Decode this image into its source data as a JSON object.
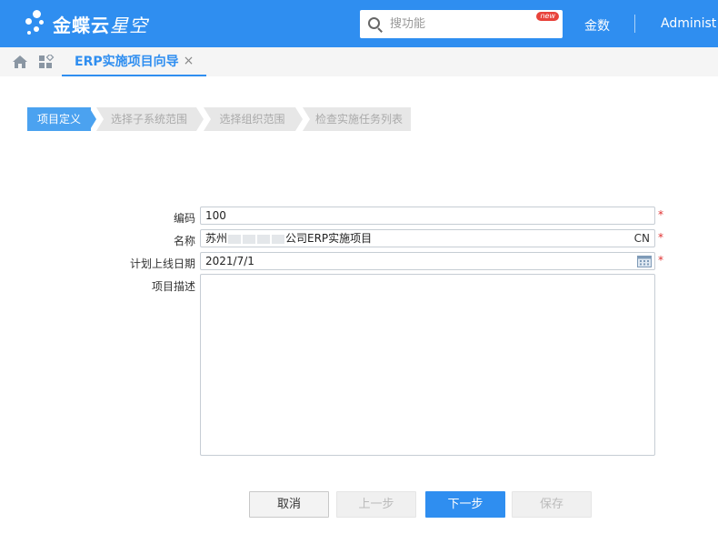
{
  "header": {
    "brand": "金蝶云",
    "brand_sub": "星空",
    "search_placeholder": "搜功能",
    "new_badge": "new",
    "user": "金数",
    "admin": "Administ"
  },
  "tabs": {
    "active_label": "ERP实施项目向导",
    "close_glyph": "×"
  },
  "steps": [
    {
      "label": "项目定义",
      "state": "active"
    },
    {
      "label": "选择子系统范围",
      "state": "inactive"
    },
    {
      "label": "选择组织范围",
      "state": "inactive"
    },
    {
      "label": "检查实施任务列表",
      "state": "inactive"
    }
  ],
  "form": {
    "code": {
      "label": "编码",
      "value": "100",
      "required": "*"
    },
    "name": {
      "label": "名称",
      "value_prefix": "苏州",
      "value_suffix": "公司ERP实施项目",
      "lang": "CN",
      "required": "*"
    },
    "date": {
      "label": "计划上线日期",
      "value": "2021/7/1",
      "required": "*"
    },
    "desc": {
      "label": "项目描述",
      "value": ""
    }
  },
  "buttons": {
    "cancel": "取消",
    "prev": "上一步",
    "next": "下一步",
    "save": "保存"
  },
  "colors": {
    "primary": "#2f8ef0",
    "step_active": "#4ba2f0",
    "required": "#e03131"
  },
  "icons": {
    "home": "home-icon",
    "apps": "apps-icon",
    "search": "search-icon",
    "calendar": "calendar-icon"
  }
}
